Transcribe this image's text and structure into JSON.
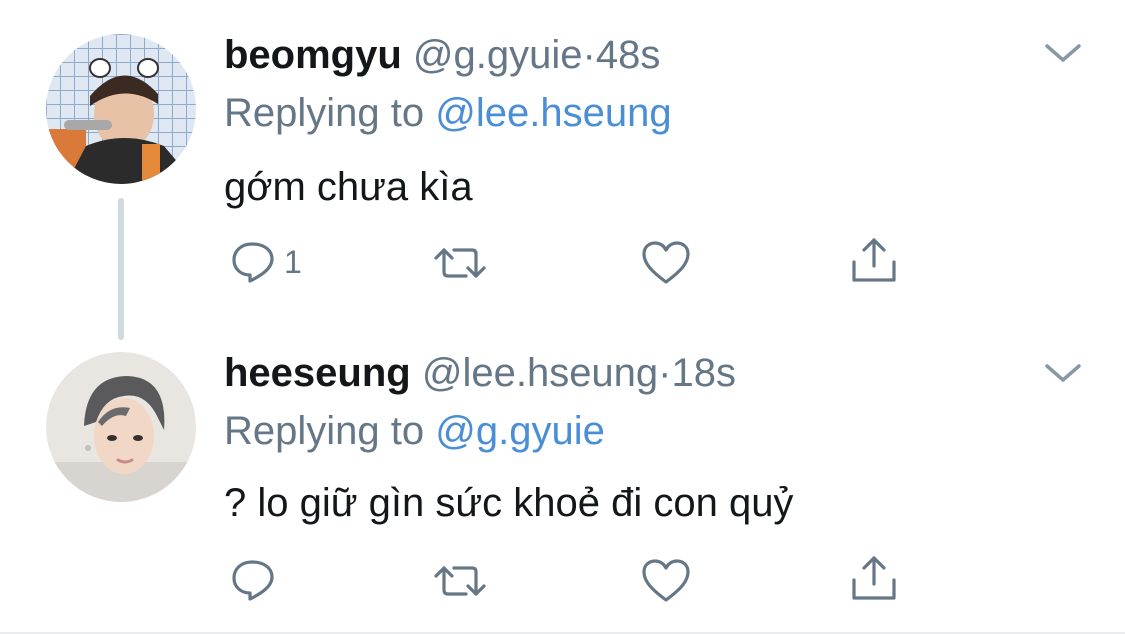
{
  "tweets": [
    {
      "name": "beomgyu",
      "handle": "@g.gyuie",
      "separator": "·",
      "time": "48s",
      "replying_prefix": "Replying to",
      "replying_to": "@lee.hseung",
      "text": "gớm chưa kìa",
      "reply_count": "1"
    },
    {
      "name": "heeseung",
      "handle": "@lee.hseung",
      "separator": "·",
      "time": "18s",
      "replying_prefix": "Replying to",
      "replying_to": "@g.gyuie",
      "text": "? lo giữ gìn sức khoẻ đi con quỷ",
      "reply_count": ""
    }
  ],
  "icons": {
    "reply": "reply-icon",
    "retweet": "retweet-icon",
    "like": "heart-icon",
    "share": "share-icon",
    "menu": "chevron-down-icon"
  },
  "colors": {
    "name": "#14171a",
    "secondary": "#657786",
    "mention": "#4a8fd6",
    "thread_line": "#cfd9de"
  }
}
